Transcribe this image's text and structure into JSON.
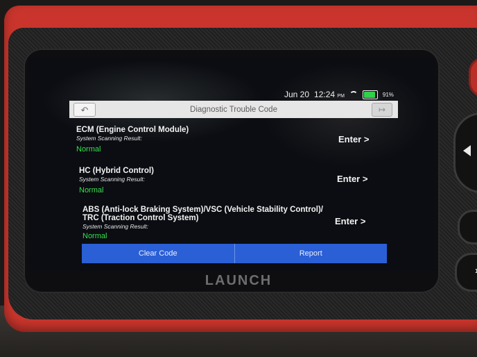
{
  "status": {
    "date": "Jun 20",
    "time": "12:24",
    "ampm": "PM",
    "battery": "91%",
    "battery_level": 0.91
  },
  "header": {
    "title": "Diagnostic Trouble Code"
  },
  "systems": [
    {
      "name": "ECM (Engine Control Module)",
      "label": "System Scanning Result:",
      "status": "Normal",
      "action": "Enter >"
    },
    {
      "name": "HC (Hybrid Control)",
      "label": "System Scanning Result:",
      "status": "Normal",
      "action": "Enter >"
    },
    {
      "name_line1": "ABS (Anti-lock Braking System)/VSC (Vehicle Stability Control)/",
      "name_line2": "TRC (Traction Control System)",
      "label": "System Scanning Result:",
      "status": "Normal",
      "action": "Enter >"
    }
  ],
  "footer": {
    "clear_label": "Clear Code",
    "report_label": "Report"
  },
  "device": {
    "brand": "LAUNCH"
  },
  "colors": {
    "status_ok": "#35e04a",
    "button_bar": "#2a5fd6",
    "device_shell": "#c9352c"
  },
  "icons": {
    "back": "back-arrow-icon",
    "exit": "exit-icon",
    "wifi": "wifi-icon",
    "battery": "battery-icon"
  }
}
